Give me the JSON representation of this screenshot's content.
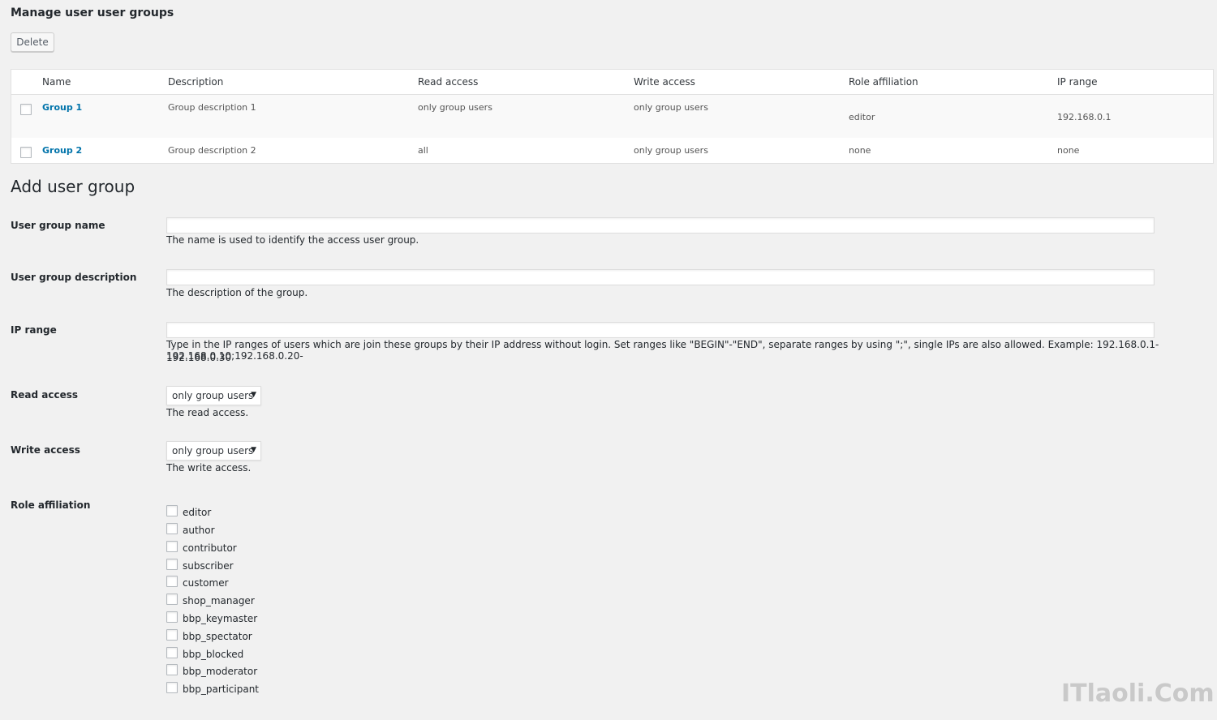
{
  "manage": {
    "title": "Manage user user groups",
    "delete_label": "Delete"
  },
  "table": {
    "headers": {
      "name": "Name",
      "description": "Description",
      "read": "Read access",
      "write": "Write access",
      "role": "Role affiliation",
      "ip": "IP range"
    },
    "rows": [
      {
        "name": "Group 1",
        "description": "Group description 1",
        "read": "only group users",
        "write": "only group users",
        "role": "editor",
        "ip": "192.168.0.1"
      },
      {
        "name": "Group 2",
        "description": "Group description 2",
        "read": "all",
        "write": "only group users",
        "role": "none",
        "ip": "none"
      }
    ]
  },
  "form": {
    "title": "Add user group",
    "name": {
      "label": "User group name",
      "value": "",
      "help": "The name is used to identify the access user group."
    },
    "description": {
      "label": "User group description",
      "value": "",
      "help": "The description of the group."
    },
    "ip_range": {
      "label": "IP range",
      "value": "",
      "help_line1": "Type in the IP ranges of users which are join these groups by their IP address without login. Set ranges like \"BEGIN\"-\"END\", separate ranges by using \";\", single IPs are also allowed. Example: 192.168.0.1-192.168.0.10;192.168.0.20-",
      "help_line2": "192.168.0.30"
    },
    "read_access": {
      "label": "Read access",
      "selected": "only group users",
      "help": "The read access."
    },
    "write_access": {
      "label": "Write access",
      "selected": "only group users",
      "help": "The write access."
    },
    "roles": {
      "label": "Role affiliation",
      "items": [
        "editor",
        "author",
        "contributor",
        "subscriber",
        "customer",
        "shop_manager",
        "bbp_keymaster",
        "bbp_spectator",
        "bbp_blocked",
        "bbp_moderator",
        "bbp_participant"
      ]
    }
  },
  "watermark": "ITlaoli.Com"
}
